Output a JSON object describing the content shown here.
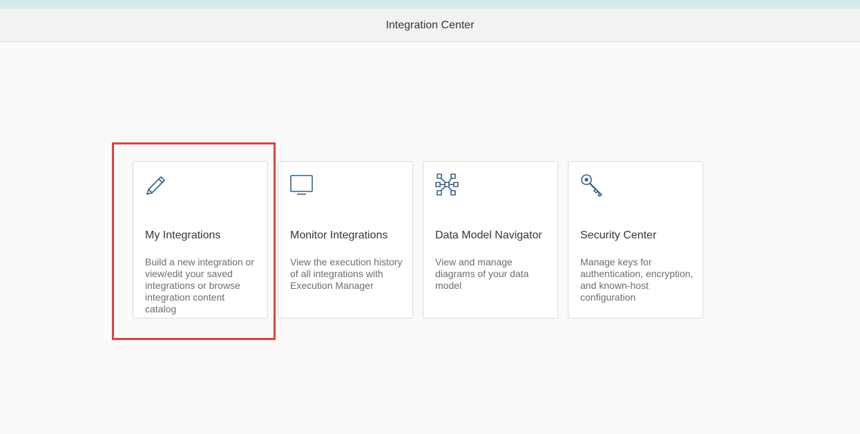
{
  "header": {
    "title": "Integration Center"
  },
  "colors": {
    "accent": "#346187",
    "highlight": "#e0413c",
    "tile_background": "#ffffff",
    "page_background": "#fafafa"
  },
  "tiles": [
    {
      "icon": "pencil-icon",
      "title": "My Integrations",
      "description": "Build a new integration or view/edit your saved integrations or browse integration content catalog",
      "highlighted": true
    },
    {
      "icon": "monitor-icon",
      "title": "Monitor Integrations",
      "description": "View the execution history of all integrations with Execution Manager"
    },
    {
      "icon": "network-icon",
      "title": "Data Model Navigator",
      "description": "View and manage diagrams of your data model"
    },
    {
      "icon": "key-icon",
      "title": "Security Center",
      "description": "Manage keys for authentication, encryption, and known-host configuration"
    }
  ]
}
